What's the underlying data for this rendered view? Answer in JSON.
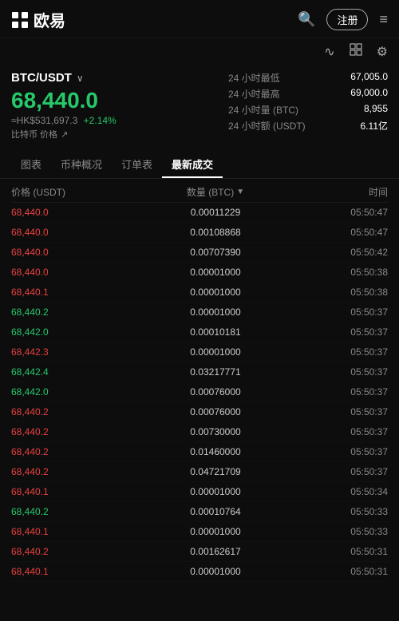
{
  "header": {
    "logo_text": "欧易",
    "register_label": "注册",
    "menu_icon": "≡"
  },
  "sub_header": {
    "chart_icon": "∿",
    "grid_icon": "⊞",
    "settings_icon": "⚙"
  },
  "pair": {
    "name": "BTC/USDT",
    "arrow": "∨"
  },
  "price": {
    "main": "68,440.0",
    "hk": "≈HK$531,697.3",
    "change": "+2.14%",
    "label": "比特币 价格",
    "link_icon": "↗"
  },
  "stats": [
    {
      "label": "24 小时最低",
      "value": "67,005.0"
    },
    {
      "label": "24 小时最高",
      "value": "69,000.0"
    },
    {
      "label": "24 小时量 (BTC)",
      "value": "8,955"
    },
    {
      "label": "24 小时额 (USDT)",
      "value": "6.11亿"
    }
  ],
  "tabs": [
    {
      "id": "chart",
      "label": "图表"
    },
    {
      "id": "overview",
      "label": "币种概况"
    },
    {
      "id": "orders",
      "label": "订单表"
    },
    {
      "id": "trades",
      "label": "最新成交",
      "active": true
    }
  ],
  "table": {
    "headers": {
      "price": "价格 (USDT)",
      "amount": "数量 (BTC)",
      "time": "时间"
    },
    "rows": [
      {
        "price": "68,440.0",
        "color": "red",
        "amount": "0.00011229",
        "time": "05:50:47"
      },
      {
        "price": "68,440.0",
        "color": "red",
        "amount": "0.00108868",
        "time": "05:50:47"
      },
      {
        "price": "68,440.0",
        "color": "red",
        "amount": "0.00707390",
        "time": "05:50:42"
      },
      {
        "price": "68,440.0",
        "color": "red",
        "amount": "0.00001000",
        "time": "05:50:38"
      },
      {
        "price": "68,440.1",
        "color": "red",
        "amount": "0.00001000",
        "time": "05:50:38"
      },
      {
        "price": "68,440.2",
        "color": "green",
        "amount": "0.00001000",
        "time": "05:50:37"
      },
      {
        "price": "68,442.0",
        "color": "green",
        "amount": "0.00010181",
        "time": "05:50:37"
      },
      {
        "price": "68,442.3",
        "color": "red",
        "amount": "0.00001000",
        "time": "05:50:37"
      },
      {
        "price": "68,442.4",
        "color": "green",
        "amount": "0.03217771",
        "time": "05:50:37"
      },
      {
        "price": "68,442.0",
        "color": "green",
        "amount": "0.00076000",
        "time": "05:50:37"
      },
      {
        "price": "68,440.2",
        "color": "red",
        "amount": "0.00076000",
        "time": "05:50:37"
      },
      {
        "price": "68,440.2",
        "color": "red",
        "amount": "0.00730000",
        "time": "05:50:37"
      },
      {
        "price": "68,440.2",
        "color": "red",
        "amount": "0.01460000",
        "time": "05:50:37"
      },
      {
        "price": "68,440.2",
        "color": "red",
        "amount": "0.04721709",
        "time": "05:50:37"
      },
      {
        "price": "68,440.1",
        "color": "red",
        "amount": "0.00001000",
        "time": "05:50:34"
      },
      {
        "price": "68,440.2",
        "color": "green",
        "amount": "0.00010764",
        "time": "05:50:33"
      },
      {
        "price": "68,440.1",
        "color": "red",
        "amount": "0.00001000",
        "time": "05:50:33"
      },
      {
        "price": "68,440.2",
        "color": "red",
        "amount": "0.00162617",
        "time": "05:50:31"
      },
      {
        "price": "68,440.1",
        "color": "red",
        "amount": "0.00001000",
        "time": "05:50:31"
      }
    ]
  }
}
